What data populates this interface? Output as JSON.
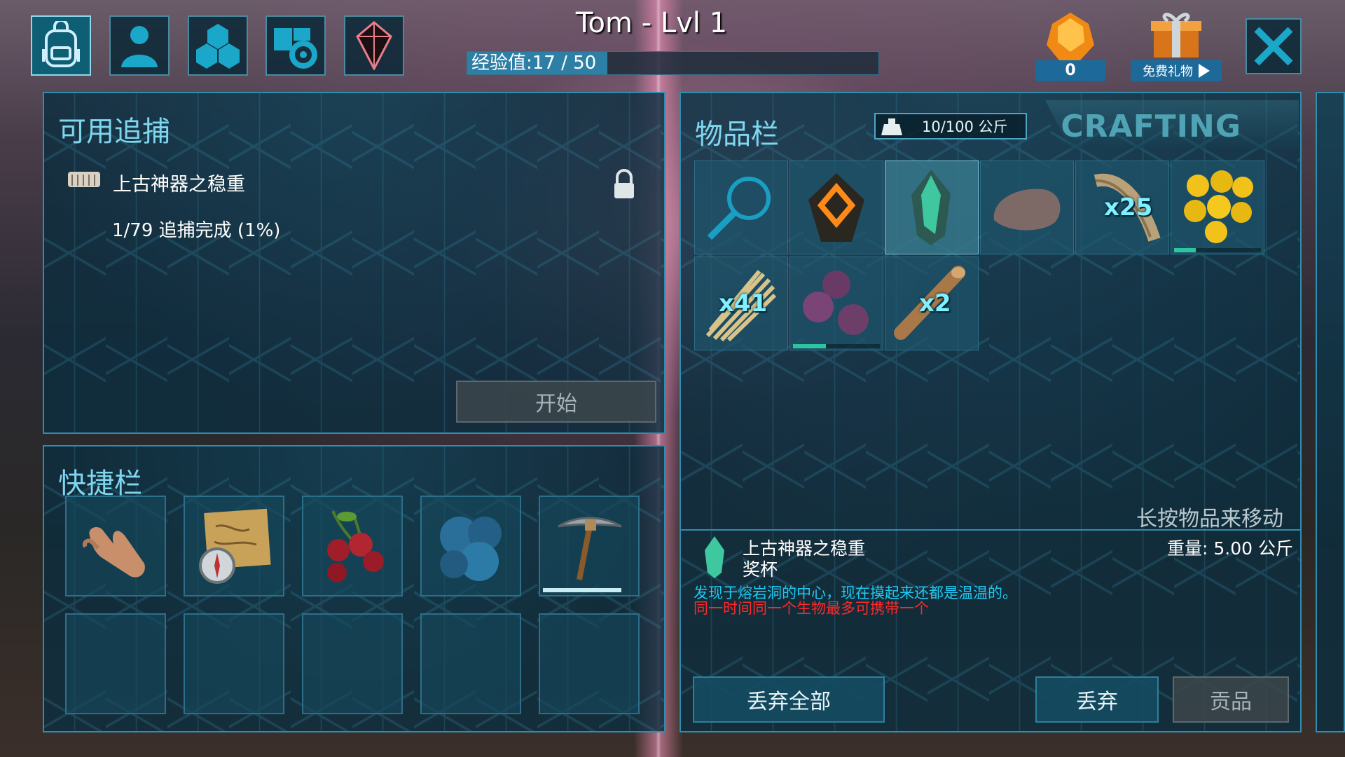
{
  "header": {
    "player_title": "Tom - Lvl 1",
    "xp_text": "经验值:17 / 50",
    "xp_progress": 0.34,
    "gem_count": "0",
    "free_gift_label": "免费礼物"
  },
  "tabs": [
    {
      "icon": "backpack-icon",
      "active": true
    },
    {
      "icon": "person-icon",
      "active": false
    },
    {
      "icon": "hexagon-tribe-icon",
      "active": false
    },
    {
      "icon": "book-gear-icon",
      "active": false
    },
    {
      "icon": "artifact-crystal-icon",
      "active": false
    }
  ],
  "hunts": {
    "title": "可用追捕",
    "item_name": "上古神器之稳重",
    "progress_text": "1/79 追捕完成 (1%)",
    "start_button": "开始"
  },
  "hotbar": {
    "title": "快捷栏",
    "slots": [
      {
        "icon": "hand-icon"
      },
      {
        "icon": "map-compass-icon"
      },
      {
        "icon": "cherry-berries-icon"
      },
      {
        "icon": "blue-berries-icon"
      },
      {
        "icon": "pickaxe-icon",
        "durability": 0.85
      }
    ]
  },
  "inventory": {
    "title": "物品栏",
    "weight_text": "10/100 公斤",
    "crafting_tab": "CRAFTING",
    "items": [
      {
        "icon": "magnifier-icon",
        "qty": ""
      },
      {
        "icon": "diamond-badge-icon",
        "qty": ""
      },
      {
        "icon": "green-crystal-artifact-icon",
        "qty": ""
      },
      {
        "icon": "stone-icon",
        "qty": ""
      },
      {
        "icon": "fiber-wood-icon",
        "qty": "x25"
      },
      {
        "icon": "yellow-berries-icon",
        "qty": "",
        "freshness": 0.25
      },
      {
        "icon": "thatch-icon",
        "qty": "x41"
      },
      {
        "icon": "purple-berries-icon",
        "qty": "",
        "freshness": 0.38
      },
      {
        "icon": "wood-log-icon",
        "qty": "x2"
      }
    ],
    "hint": "长按物品来移动",
    "detail": {
      "name": "上古神器之稳重",
      "subtitle": "奖杯",
      "weight": "重量: 5.00 公斤",
      "description": "发现于熔岩洞的中心，现在摸起来还都是温温的。",
      "warning": "同一时间同一个生物最多可携带一个"
    },
    "buttons": {
      "drop_all": "丢弃全部",
      "drop": "丢弃",
      "tribute": "贡品"
    }
  }
}
